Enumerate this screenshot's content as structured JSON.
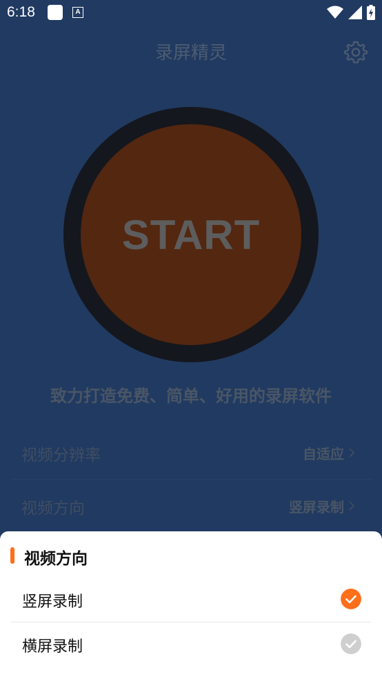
{
  "status_bar": {
    "time": "6:18",
    "keyboard_glyph": "A"
  },
  "header": {
    "title": "录屏精灵"
  },
  "start_button": {
    "label": "START"
  },
  "slogan": "致力打造免费、简单、好用的录屏软件",
  "settings": [
    {
      "label": "视频分辨率",
      "value": "自适应"
    },
    {
      "label": "视频方向",
      "value": "竖屏录制"
    }
  ],
  "sheet": {
    "title": "视频方向",
    "options": [
      {
        "label": "竖屏录制",
        "selected": true
      },
      {
        "label": "横屏录制",
        "selected": false
      }
    ]
  },
  "colors": {
    "background": "#213a61",
    "accent": "#ff6f1a",
    "unselected_check": "#cfcfcf"
  },
  "icons": [
    "wifi-icon",
    "signal-icon",
    "battery-icon",
    "gear-icon",
    "chevron-right-icon",
    "check-circle-icon"
  ]
}
